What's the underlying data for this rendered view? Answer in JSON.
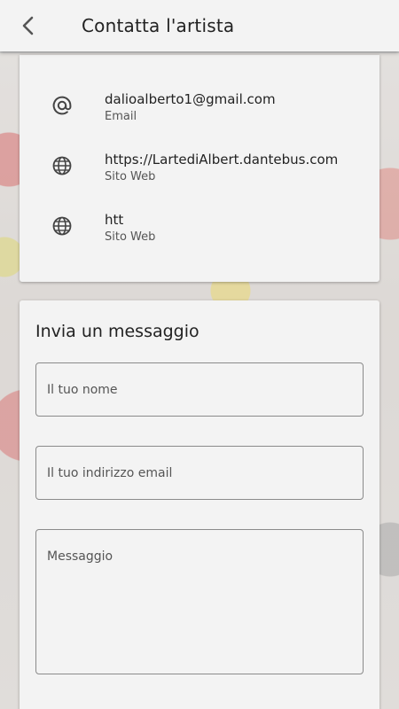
{
  "header": {
    "title": "Contatta l'artista",
    "back_icon": "chevron-left-icon"
  },
  "contacts": [
    {
      "icon": "at-icon",
      "value": "dalioalberto1@gmail.com",
      "label": "Email"
    },
    {
      "icon": "globe-icon",
      "value": "https://LartediAlbert.dantebus.com",
      "label": "Sito Web"
    },
    {
      "icon": "globe-icon",
      "value": "htt",
      "label": "Sito Web"
    }
  ],
  "form": {
    "title": "Invia un messaggio",
    "name_placeholder": "Il tuo nome",
    "email_placeholder": "Il tuo indirizzo email",
    "message_placeholder": "Messaggio"
  },
  "colors": {
    "appbar": "#f3f3f3",
    "card": "#f3f3f3",
    "text": "#222222",
    "border": "#8a8a8a"
  }
}
